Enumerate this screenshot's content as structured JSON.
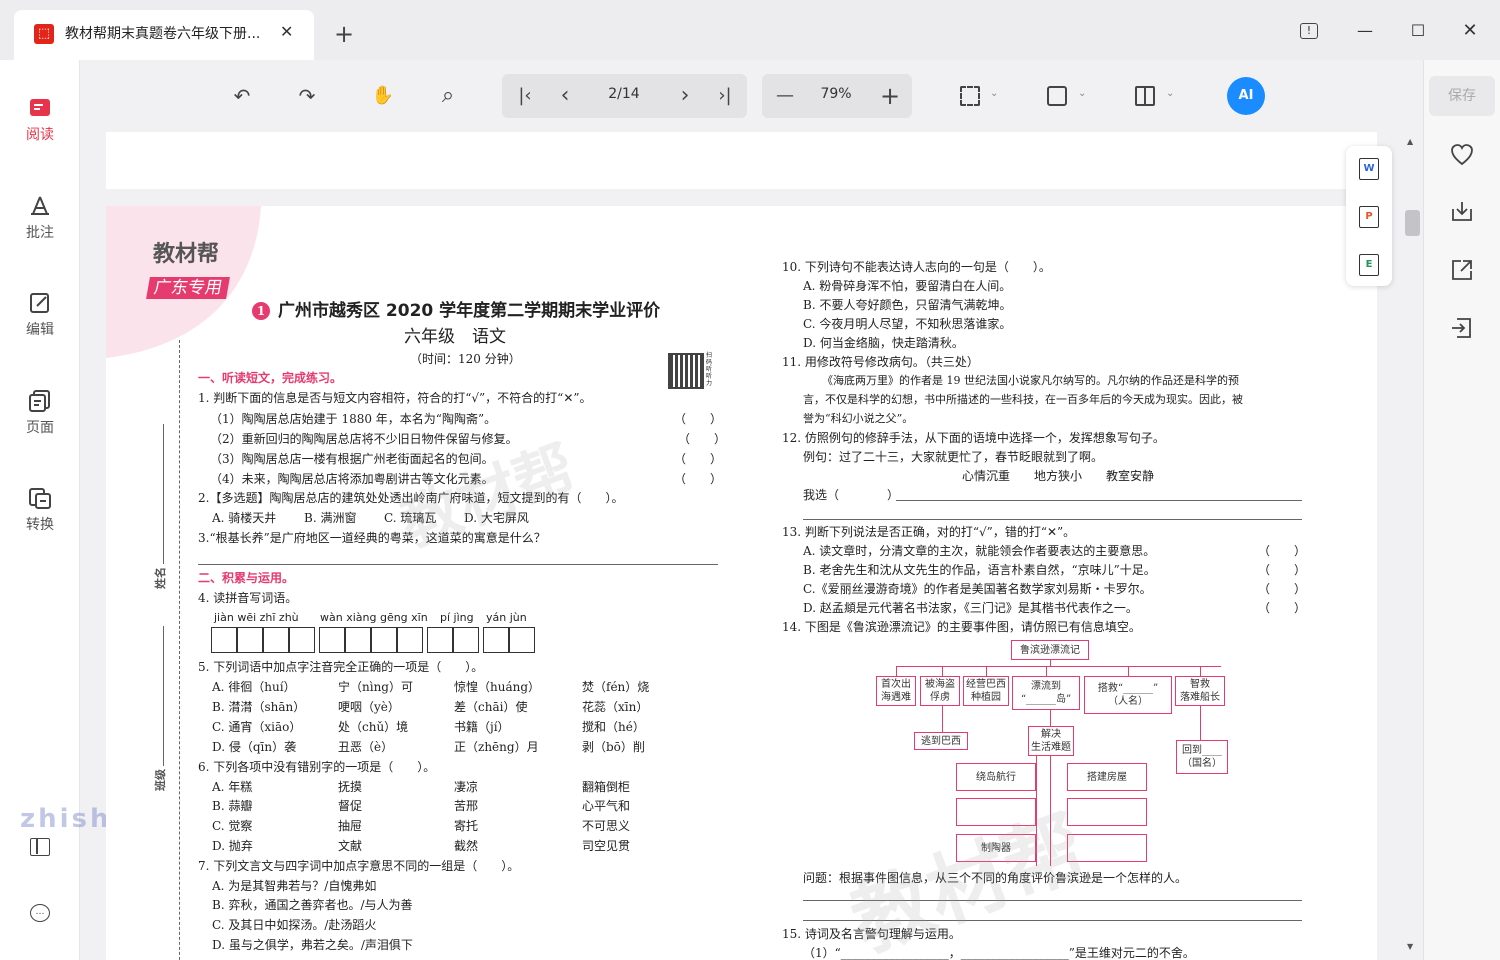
{
  "window": {
    "tab_title": "教材帮期末真题卷六年级下册...",
    "tab_close": "✕",
    "new_tab": "+",
    "feedback": "!",
    "minimize": "—",
    "maximize": "☐",
    "close": "✕"
  },
  "sidebar": {
    "items": [
      {
        "label": "阅读",
        "icon": "read-icon",
        "active": true
      },
      {
        "label": "批注",
        "icon": "annotate-icon"
      },
      {
        "label": "编辑",
        "icon": "edit-icon"
      },
      {
        "label": "页面",
        "icon": "pages-icon"
      },
      {
        "label": "转换",
        "icon": "convert-icon"
      }
    ]
  },
  "toolbar": {
    "page_indicator": "2/14",
    "zoom": "79%",
    "ai_label": "AI",
    "undo": "↶",
    "redo": "↷",
    "hand": "✋",
    "search": "⌕",
    "first": "|‹",
    "prev": "‹",
    "next": "›",
    "last": "›|",
    "zoom_out": "—",
    "zoom_in": "+"
  },
  "right_panel": {
    "save_label": "保存"
  },
  "floating": [
    "W",
    "P",
    "E"
  ],
  "watermark_site": "zhishi.im",
  "doc": {
    "brand": "教材帮",
    "brand_sub": "广东专用",
    "num": "1",
    "title": "广州市越秀区 2020 学年度第二学期期末学业评价",
    "subtitle": "六年级　语文",
    "time": "（时间：120 分钟）",
    "qr_text": "扫码听听力",
    "side_name": "姓名",
    "side_class": "班级",
    "watermark": "教材帮",
    "left": {
      "sec1": "一、听读短文，完成练习。",
      "q1": "1. 判断下面的信息是否与短文内容相符，符合的打“√”，不符合的打“✕”。",
      "q1_1": "（1）陶陶居总店始建于 1880 年，本名为“陶陶斋”。",
      "q1_2": "（2）重新回归的陶陶居总店将不少旧日物件保留与修复。",
      "q1_3": "（3）陶陶居总店一楼有根据广州老街面起名的包间。",
      "q1_4": "（4）未来，陶陶居总店将添加粤剧讲古等文化元素。",
      "paren": "（　　）",
      "q2": "2.【多选题】陶陶居总店的建筑处处透出岭南广府味道，短文提到的有（　　）。",
      "q2_opts": [
        "A. 骑楼天井",
        "B. 满洲窗",
        "C. 琉璃瓦",
        "D. 大宅屏风"
      ],
      "q3": "3.“根基长养”是广府地区一道经典的粤菜，这道菜的寓意是什么？",
      "sec2": "二、积累与运用。",
      "q4": "4. 读拼音写词语。",
      "pinyin": [
        "jiàn  wēi  zhī  zhù",
        "wàn  xiàng  gēng  xīn",
        "pí  jìng",
        "yán  jùn"
      ],
      "q5": "5. 下列词语中加点字注音完全正确的一项是（　　）。",
      "q5_rows": [
        [
          "A. 徘徊（huí）",
          "宁（nìng）可",
          "惊惶（huáng）",
          "焚（fén）烧"
        ],
        [
          "B. 潸潸（shān）",
          "哽咽（yè）",
          "差（chāi）使",
          "花蕊（xīn）"
        ],
        [
          "C. 通宵（xiāo）",
          "处（chǔ）境",
          "书籍（jí）",
          "搅和（hé）"
        ],
        [
          "D. 侵（qīn）袭",
          "丑恶（è）",
          "正（zhēng）月",
          "剥（bō）削"
        ]
      ],
      "q6": "6. 下列各项中没有错别字的一项是（　　）。",
      "q6_rows": [
        [
          "A. 年糕",
          "抚摸",
          "凄凉",
          "翻箱倒柜"
        ],
        [
          "B. 蒜瓣",
          "督促",
          "苦邢",
          "心平气和"
        ],
        [
          "C. 觉察",
          "抽屉",
          "寄托",
          "不可思义"
        ],
        [
          "D. 抛弃",
          "文献",
          "截然",
          "司空见贯"
        ]
      ],
      "q7": "7. 下列文言文与四字词中加点字意思不同的一组是（　　）。",
      "q7_opts": [
        "A. 为是其智弗若与？/自愧弗如",
        "B. 弈秋，通国之善弈者也。/与人为善",
        "C. 及其日中如探汤。/赴汤蹈火",
        "D. 虽与之俱学，弗若之矣。/声泪俱下"
      ]
    },
    "right": {
      "q10": "10. 下列诗句不能表达诗人志向的一句是（　　）。",
      "q10_opts": [
        "A. 粉骨碎身浑不怕，要留清白在人间。",
        "B. 不要人夸好颜色，只留清气满乾坤。",
        "C. 今夜月明人尽望，不知秋思落谁家。",
        "D. 何当金络脑，快走踏清秋。"
      ],
      "q11": "11. 用修改符号修改病句。（共三处）",
      "q11_text": [
        "《海底两万里》的作者是 19 世纪法国小说家凡尔纳写的。凡尔纳的作品还是科学的预",
        "言，不仅是科学的幻想，书中所描述的一些科技，在一百多年后的今天成为现实。因此，被",
        "誉为“科幻小说之父”。"
      ],
      "q12": "12. 仿照例句的修辞手法，从下面的语境中选择一个，发挥想象写句子。",
      "q12_example": "例句：过了二十三，大家就更忙了，春节眨眼就到了啊。",
      "q12_options": "心情沉重　　地方狭小　　教室安静",
      "q12_choose": "我选（　　　　）",
      "q13": "13. 判断下列说法是否正确，对的打“√”，错的打“✕”。",
      "q13_opts": [
        "A. 读文章时，分清文章的主次，就能领会作者要表达的主要意思。",
        "B. 老舍先生和沈从文先生的作品，语言朴素自然，“京味儿”十足。",
        "C.《爱丽丝漫游奇境》的作者是美国著名数学家刘易斯・卡罗尔。",
        "D. 赵孟頫是元代著名书法家，《三门记》是其楷书代表作之一。"
      ],
      "q14": "14. 下图是《鲁滨逊漂流记》的主要事件图，请仿照已有信息填空。",
      "diagram": {
        "root": "鲁滨逊漂流记",
        "b1": "首次出\n海遇难",
        "b2": "被海盗\n俘虏",
        "b3": "经营巴西\n种植园",
        "b4": "漂流到\n“______岛”",
        "b5": "搭救“______”\n（人名）",
        "b6": "智救\n落难船长",
        "c1": "逃到巴西",
        "c2": "解决\n生活难题",
        "c3": "回到____\n（国名）",
        "d1": "绕岛航行",
        "d2": "搭建房屋",
        "d3": "制陶器"
      },
      "q14_question": "问题：根据事件图信息，从三个不同的角度评价鲁滨逊是一个怎样的人。",
      "q15": "15. 诗词及名言警句理解与运用。",
      "q15_1": "（1）“__________________，__________________”是王维对元二的不舍。"
    }
  }
}
